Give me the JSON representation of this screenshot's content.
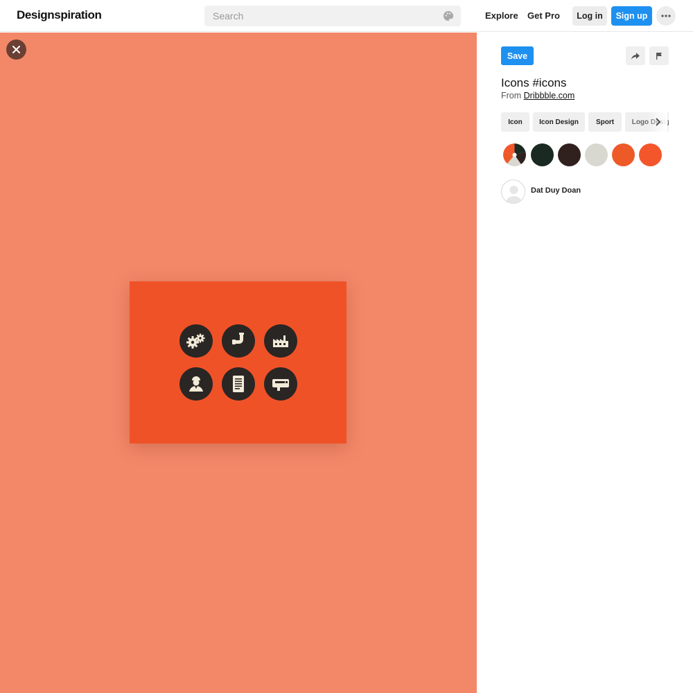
{
  "header": {
    "logo": "Designspiration",
    "search_placeholder": "Search",
    "nav": {
      "explore": "Explore",
      "get_pro": "Get Pro"
    },
    "login_label": "Log in",
    "signup_label": "Sign up",
    "icons": {
      "palette": "palette-icon",
      "more": "more-dots-icon"
    }
  },
  "stage": {
    "background_color": "#f38869",
    "artwork_color": "#f05228",
    "artwork_icons": [
      "gears-icon",
      "pipe-icon",
      "factory-icon",
      "worker-icon",
      "document-icon",
      "machine-icon"
    ],
    "close_icon": "close-icon"
  },
  "sidebar": {
    "save_label": "Save",
    "share_icon": "share-icon",
    "flag_icon": "flag-icon",
    "title": "Icons #icons",
    "from_label": "From",
    "source": "Dribbble.com",
    "tags": [
      "Icon",
      "Icon Design",
      "Sport",
      "Logo Design"
    ],
    "colors": [
      "#1a2a22",
      "#30211e",
      "#d9d8d0",
      "#ed5a28",
      "#f4562c"
    ],
    "author": "Dat Duy Doan"
  }
}
